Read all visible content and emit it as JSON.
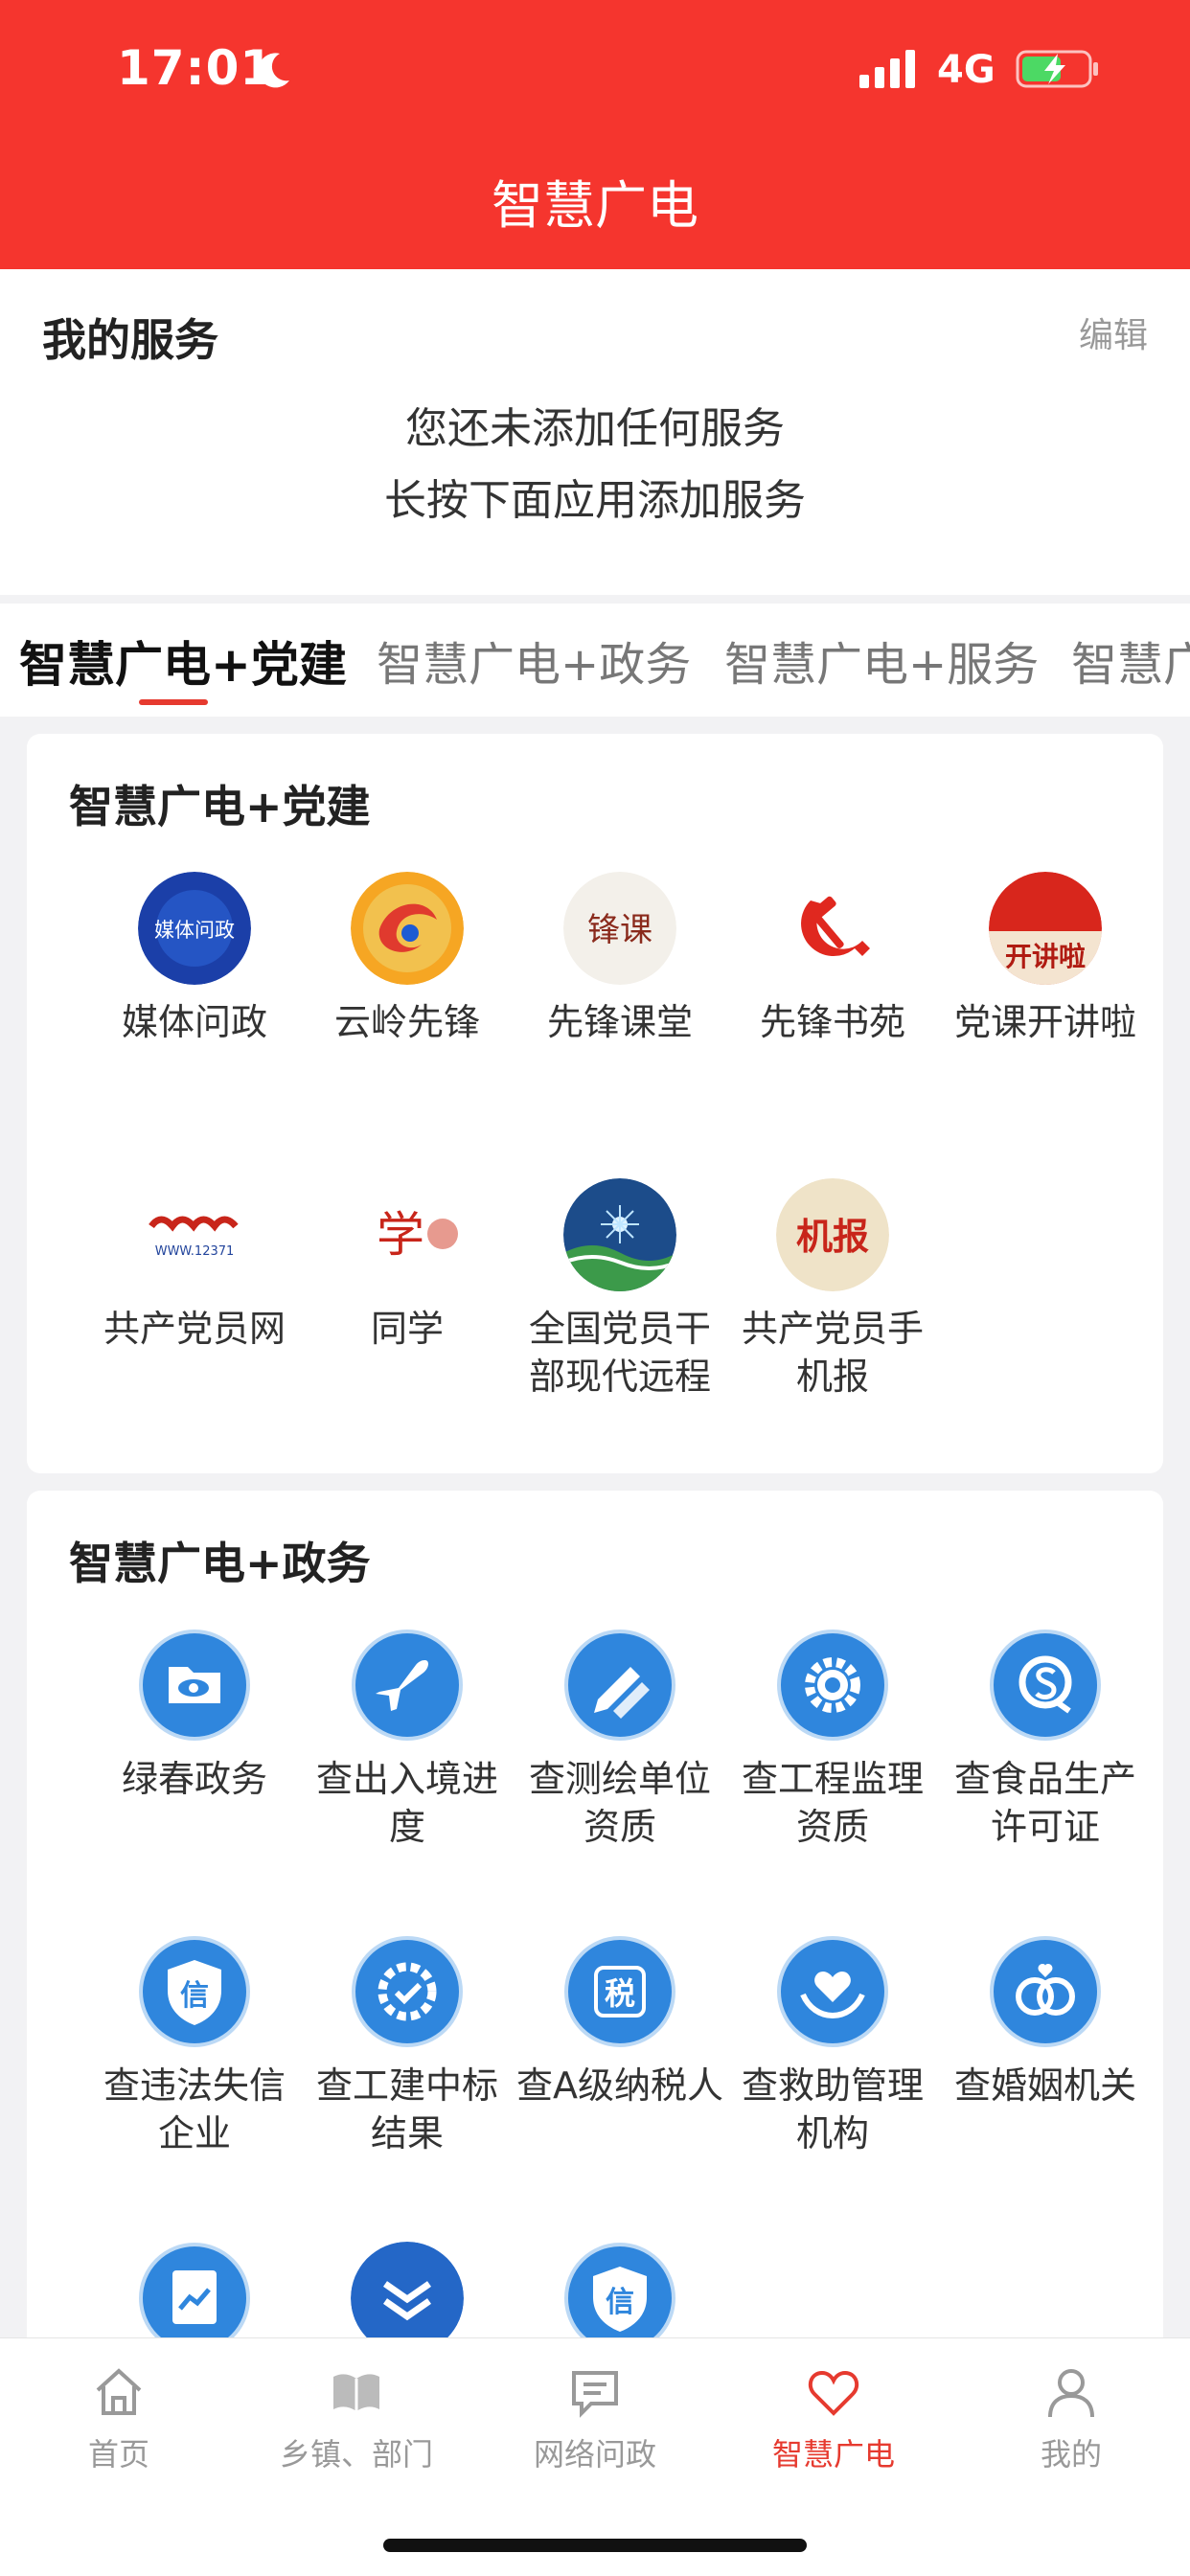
{
  "status_bar": {
    "time": "17:01",
    "network": "4G"
  },
  "header": {
    "title": "智慧广电"
  },
  "my_services": {
    "title": "我的服务",
    "edit_label": "编辑",
    "empty_line1": "您还未添加任何服务",
    "empty_line2": "长按下面应用添加服务"
  },
  "tabs": [
    "智慧广电+党建",
    "智慧广电+政务",
    "智慧广电+服务",
    "智慧广"
  ],
  "sections": [
    {
      "title": "智慧广电+党建",
      "items": [
        {
          "label": "媒体问政",
          "icon_text": "媒体问政"
        },
        {
          "label": "云岭先锋"
        },
        {
          "label": "先锋课堂",
          "icon_text": "锋课"
        },
        {
          "label": "先锋书苑"
        },
        {
          "label": "党课开讲啦",
          "icon_text": "开讲啦"
        },
        {
          "label": "共产党员网",
          "icon_text": "WWW.12371"
        },
        {
          "label": "同学",
          "icon_text": "学"
        },
        {
          "label": "全国党员干部现代远程"
        },
        {
          "label": "共产党员手机报",
          "icon_text": "机报"
        }
      ]
    },
    {
      "title": "智慧广电+政务",
      "items": [
        {
          "label": "绿春政务"
        },
        {
          "label": "查出入境进度"
        },
        {
          "label": "查测绘单位资质"
        },
        {
          "label": "查工程监理资质"
        },
        {
          "label": "查食品生产许可证"
        },
        {
          "label": "查违法失信企业",
          "icon_text": "信"
        },
        {
          "label": "查工建中标结果"
        },
        {
          "label": "查A级纳税人",
          "icon_text": "税"
        },
        {
          "label": "查救助管理机构"
        },
        {
          "label": "查婚姻机关"
        },
        {
          "label": ""
        },
        {
          "label": ""
        },
        {
          "label": "",
          "icon_text": "信"
        }
      ]
    }
  ],
  "bottom_nav": [
    {
      "label": "首页"
    },
    {
      "label": "乡镇、部门"
    },
    {
      "label": "网络问政"
    },
    {
      "label": "智慧广电",
      "active": true
    },
    {
      "label": "我的"
    }
  ],
  "colors": {
    "brand_red": "#f5352e",
    "accent_red": "#e63a2f",
    "icon_blue": "#2f86dd"
  }
}
